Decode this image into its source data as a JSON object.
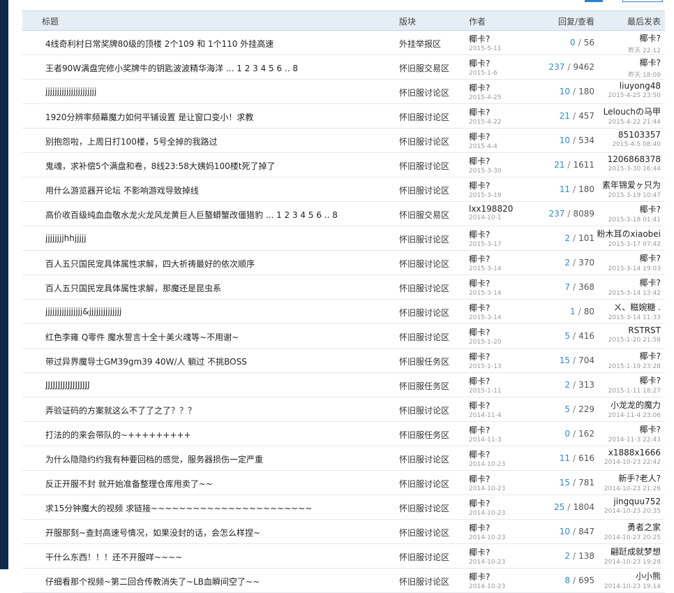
{
  "header": {
    "title": "标题",
    "forum": "版块",
    "author": "作者",
    "replies_views": "回复/查看",
    "last_post": "最后发表"
  },
  "threads": [
    {
      "title": "4线奇利村日常奖牌80级的顶楼 2个109 和 1个110 外挂高速",
      "forum": "外挂举报区",
      "author": "椰卡?",
      "date": "2015-5-11",
      "replies": "0",
      "views": "56",
      "last_name": "椰卡?",
      "last_date": "昨天 22:12"
    },
    {
      "title": "王者90W满盘完修小奖牌牛的钥匙波波精华海洋 ... 1 2 3 4 5 6 .. 8",
      "forum": "怀旧服交易区",
      "author": "椰卡?",
      "date": "2015-1-6",
      "replies": "237",
      "views": "9462",
      "last_name": "椰卡?",
      "last_date": "昨天 18:09"
    },
    {
      "title": "jjjjjjjjjjjjjjjjjjjjjj",
      "forum": "怀旧服讨论区",
      "author": "椰卡?",
      "date": "2015-4-25",
      "replies": "10",
      "views": "180",
      "last_name": "liuyong48",
      "last_date": "2015-4-25 23:50"
    },
    {
      "title": "1920分辨率频幕魔力如何平铺设置 是让窗口变小！求教",
      "forum": "怀旧服讨论区",
      "author": "椰卡?",
      "date": "2015-4-22",
      "replies": "21",
      "views": "457",
      "last_name": "Lelouchの马甲",
      "last_date": "2015-4-22 21:44"
    },
    {
      "title": "别抱怨啦，上周日打100楼，5号全掉的我路过",
      "forum": "怀旧服讨论区",
      "author": "椰卡?",
      "date": "2015-4-4",
      "replies": "10",
      "views": "534",
      "last_name": "85103357",
      "last_date": "2015-4-5 08:40"
    },
    {
      "title": "鬼魂，求补偿5个满盘和卷，8线23:58大姨妈100楼t死了掉了",
      "forum": "怀旧服讨论区",
      "author": "椰卡?",
      "date": "2015-3-30",
      "replies": "21",
      "views": "1611",
      "last_name": "1206868378",
      "last_date": "2015-3-30 16:44"
    },
    {
      "title": "用什么游览器开论坛 不影响游戏导致掉线",
      "forum": "怀旧服讨论区",
      "author": "椰卡?",
      "date": "2015-3-19",
      "replies": "11",
      "views": "180",
      "last_name": "素年锦爱ヶ只为",
      "last_date": "2015-3-19 10:47"
    },
    {
      "title": "高价收百级纯血血敬水龙火龙风龙黄巨人巨螯蟒蟹改僵猎豹 ... 1 2 3 4 5 6 .. 8",
      "forum": "怀旧服交易区",
      "author": "lxx198820",
      "date": "2014-10-1",
      "replies": "237",
      "views": "8089",
      "last_name": "椰卡?",
      "last_date": "2015-3-18 01:41"
    },
    {
      "title": "jjjjjjjjhhjjjjj",
      "forum": "怀旧服讨论区",
      "author": "椰卡?",
      "date": "2015-3-17",
      "replies": "2",
      "views": "101",
      "last_name": "粉木耳のxiaobei",
      "last_date": "2015-3-17 07:42"
    },
    {
      "title": "百人五只国民宠具体属性求解，四大祈祷最好的依次顺序",
      "forum": "怀旧服讨论区",
      "author": "椰卡?",
      "date": "2015-3-14",
      "replies": "2",
      "views": "370",
      "last_name": "椰卡?",
      "last_date": "2015-3-14 19:03"
    },
    {
      "title": "百人五只国民宠具体属性求解，那魔还是昆虫系",
      "forum": "怀旧服讨论区",
      "author": "椰卡?",
      "date": "2015-3-14",
      "replies": "7",
      "views": "368",
      "last_name": "椰卡?",
      "last_date": "2015-3-14 13:42"
    },
    {
      "title": "jjjjjjjjjjjjjjjj&jjjjjjjjjjjjjj",
      "forum": "怀旧服讨论区",
      "author": "椰卡?",
      "date": "2015-3-14",
      "replies": "1",
      "views": "80",
      "last_name": "ㄨ、糍婉糖 .",
      "last_date": "2015-3-14 11:33"
    },
    {
      "title": "红色李雍 Q零件 魔水誓言十全十美火魂等~不用谢~",
      "forum": "怀旧服讨论区",
      "author": "椰卡?",
      "date": "2015-1-20",
      "replies": "5",
      "views": "416",
      "last_name": "RSTRST",
      "last_date": "2015-1-20 21:58"
    },
    {
      "title": "带过异界魔导士GM39gm39 40W/人 躺过 不挑BOSS",
      "forum": "怀旧服任务区",
      "author": "椰卡?",
      "date": "2015-1-13",
      "replies": "15",
      "views": "704",
      "last_name": "椰卡?",
      "last_date": "2015-1-19 23:28"
    },
    {
      "title": "JJJJJJJJJJJJJJJJJJ",
      "forum": "怀旧服任务区",
      "author": "椰卡?",
      "date": "2015-1-11",
      "replies": "2",
      "views": "313",
      "last_name": "椰卡?",
      "last_date": "2015-1-11 18:27"
    },
    {
      "title": "弄验证码的方案就这么不了了之了？？？",
      "forum": "怀旧服讨论区",
      "author": "椰卡?",
      "date": "2014-11-4",
      "replies": "5",
      "views": "229",
      "last_name": "小龙龙的魔力",
      "last_date": "2014-11-4 23:06"
    },
    {
      "title": "打法的的来会带队的~+++++++++",
      "forum": "怀旧服任务区",
      "author": "椰卡?",
      "date": "2014-11-3",
      "replies": "0",
      "views": "162",
      "last_name": "椰卡?",
      "last_date": "2014-11-3 22:43"
    },
    {
      "title": "为什么隐隐约约我有种要回档的感觉，服务器损伤一定严重",
      "forum": "怀旧服讨论区",
      "author": "椰卡?",
      "date": "2014-10-23",
      "replies": "11",
      "views": "616",
      "last_name": "x1888x1666",
      "last_date": "2014-10-23 22:42"
    },
    {
      "title": "反正开服不封 就开始准备整理仓库甩卖了~~",
      "forum": "怀旧服讨论区",
      "author": "椰卡?",
      "date": "2014-10-23",
      "replies": "15",
      "views": "781",
      "last_name": "新手?老人?",
      "last_date": "2014-10-23 21:26"
    },
    {
      "title": "求15分钟魔大的视频 求链接~~~~~~~~~~~~~~~~~~~~~~~",
      "forum": "怀旧服讨论区",
      "author": "椰卡?",
      "date": "2014-10-23",
      "replies": "25",
      "views": "1804",
      "last_name": "jingquu752",
      "last_date": "2014-10-23 20:35"
    },
    {
      "title": "开服那刻~查封高速号情况，如果没封的话，会怎么样捏~",
      "forum": "怀旧服讨论区",
      "author": "椰卡?",
      "date": "2014-10-23",
      "replies": "10",
      "views": "847",
      "last_name": "勇者之家",
      "last_date": "2014-10-23 20:25"
    },
    {
      "title": "干什么东西！！！还不开服咩~~~~",
      "forum": "怀旧服讨论区",
      "author": "椰卡?",
      "date": "2014-10-23",
      "replies": "2",
      "views": "138",
      "last_name": "翩跹成就梦想",
      "last_date": "2014-10-23 19:28"
    },
    {
      "title": "仔细看那个视频~第二回合传教消失了~LB血瞬间空了~~",
      "forum": "怀旧服讨论区",
      "author": "椰卡?",
      "date": "2014-10-23",
      "replies": "8",
      "views": "695",
      "last_name": "小小熊",
      "last_date": "2014-10-23 19:14"
    }
  ]
}
